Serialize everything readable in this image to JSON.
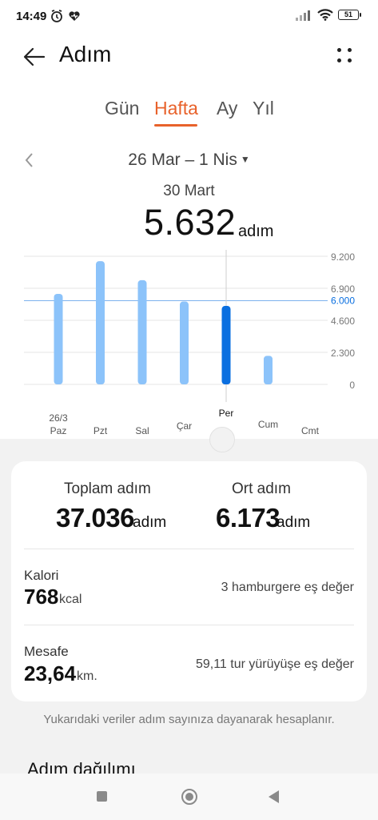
{
  "status": {
    "time": "14:49",
    "battery": "51"
  },
  "header": {
    "title": "Adım"
  },
  "tabs": [
    "Gün",
    "Hafta",
    "Ay",
    "Yıl"
  ],
  "active_tab": "Hafta",
  "date_range": "26 Mar – 1 Nis",
  "selected_day": "30 Mart",
  "selected_steps": "5.632",
  "steps_unit": "adım",
  "chart_data": {
    "type": "bar",
    "categories": [
      "Paz",
      "Pzt",
      "Sal",
      "Çar",
      "Per",
      "Cum",
      "Cmt"
    ],
    "date_label_first": "26/3",
    "values": [
      6500,
      8850,
      7480,
      5950,
      5632,
      2050,
      0
    ],
    "selected_index": 4,
    "y_ticks": [
      "9.200",
      "6.900",
      "4.600",
      "2.300",
      "0"
    ],
    "goal": 6000,
    "goal_label": "6.000",
    "ylim": [
      0,
      9200
    ],
    "colors": {
      "bar": "#8cc3fa",
      "selected": "#0a6fe0",
      "goal": "#0a6fe0"
    }
  },
  "summary": {
    "total_label": "Toplam adım",
    "total_value": "37.036",
    "total_unit": "adım",
    "avg_label": "Ort adım",
    "avg_value": "6.173",
    "avg_unit": "adım",
    "calories_label": "Kalori",
    "calories_value": "768",
    "calories_unit": "kcal",
    "calories_equiv": "3 hamburgere eş değer",
    "distance_label": "Mesafe",
    "distance_value": "23,64",
    "distance_unit": "km.",
    "distance_equiv": "59,11 tur yürüyüşe eş değer"
  },
  "footnote": "Yukarıdaki veriler adım sayınıza dayanarak hesaplanır.",
  "section_title": "Adım dağılımı",
  "colors": {
    "accent": "#e8622b"
  }
}
